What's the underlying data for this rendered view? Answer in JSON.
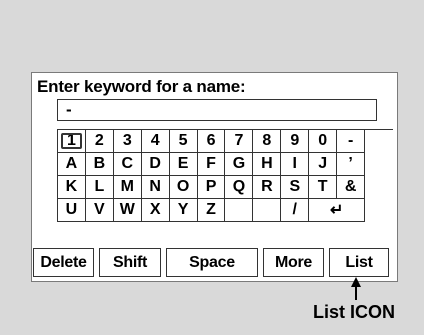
{
  "prompt": "Enter keyword for a name:",
  "input": {
    "value": "-"
  },
  "keys": [
    "1",
    "2",
    "3",
    "4",
    "5",
    "6",
    "7",
    "8",
    "9",
    "0",
    "-",
    "A",
    "B",
    "C",
    "D",
    "E",
    "F",
    "G",
    "H",
    "I",
    "J",
    "’",
    "K",
    "L",
    "M",
    "N",
    "O",
    "P",
    "Q",
    "R",
    "S",
    "T",
    "&",
    "U",
    "V",
    "W",
    "X",
    "Y",
    "Z",
    "",
    "",
    "/",
    "↵"
  ],
  "functions": {
    "delete": "Delete",
    "shift": "Shift",
    "space": "Space",
    "more": "More",
    "list": "List"
  },
  "callout": {
    "label": "List ICON"
  }
}
